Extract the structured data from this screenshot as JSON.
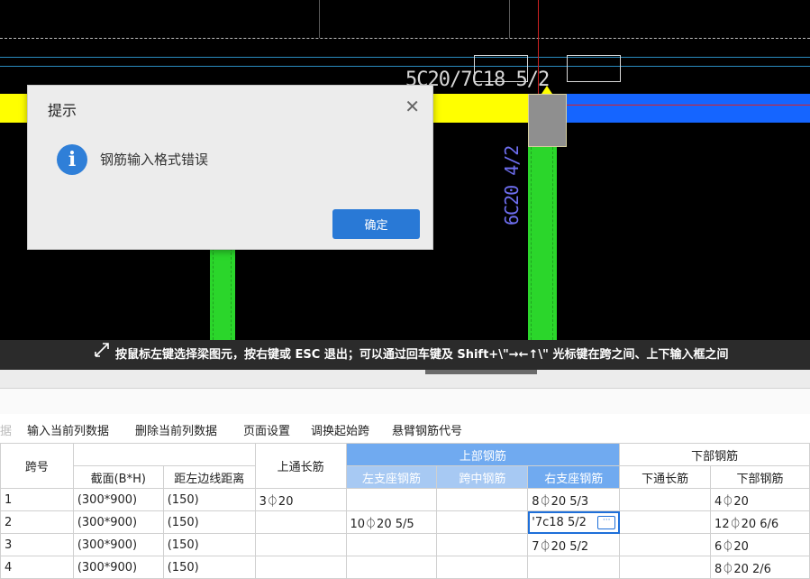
{
  "cad": {
    "beam_label": "5C20/7C18 5/2",
    "column_label": "6C20 4/2",
    "colors": {
      "background": "#000000",
      "beam": "#ffff00",
      "beam_selected": "#1565ff",
      "column": "#2bd62b"
    }
  },
  "status_bar": {
    "icon": "cursor-arrows-icon",
    "text": "按鼠标左键选择梁图元，按右键或 ESC 退出；可以通过回车键及 Shift+\\\"→←↑\\\" 光标键在跨之间、上下输入框之间"
  },
  "toolbar": {
    "partial_label": "据",
    "items": [
      "输入当前列数据",
      "删除当前列数据",
      "页面设置",
      "调换起始跨",
      "悬臂钢筋代号"
    ]
  },
  "table": {
    "headers": {
      "span_no": "跨号",
      "section": "截面(B*H)",
      "offset": "距左边线距离",
      "top_through": "上通长筋",
      "top_group": "上部钢筋",
      "left_support": "左支座钢筋",
      "mid_span": "跨中钢筋",
      "right_support": "右支座钢筋",
      "bottom_group": "下部钢筋",
      "bottom_through": "下通长筋",
      "bottom_rebar": "下部钢筋"
    },
    "rows": [
      {
        "span": "1",
        "section": "(300*900)",
        "offset": "(150)",
        "top_through": "3⏀20",
        "left": "",
        "mid": "",
        "right": "8⏀20 5/3",
        "bottom_through": "",
        "bottom": "4⏀20"
      },
      {
        "span": "2",
        "section": "(300*900)",
        "offset": "(150)",
        "top_through": "",
        "left": "10⏀20 5/5",
        "mid": "",
        "right": "'7c18 5/2",
        "bottom_through": "",
        "bottom": "12⏀20 6/6"
      },
      {
        "span": "3",
        "section": "(300*900)",
        "offset": "(150)",
        "top_through": "",
        "left": "",
        "mid": "",
        "right": "7⏀20 5/2",
        "bottom_through": "",
        "bottom": "6⏀20"
      },
      {
        "span": "4",
        "section": "(300*900)",
        "offset": "(150)",
        "top_through": "",
        "left": "",
        "mid": "",
        "right": "",
        "bottom_through": "",
        "bottom": "8⏀20 2/6"
      }
    ]
  },
  "dialog": {
    "title": "提示",
    "message": "钢筋输入格式错误",
    "ok_label": "确定",
    "icon": "info-icon",
    "close_icon": "close-icon"
  }
}
